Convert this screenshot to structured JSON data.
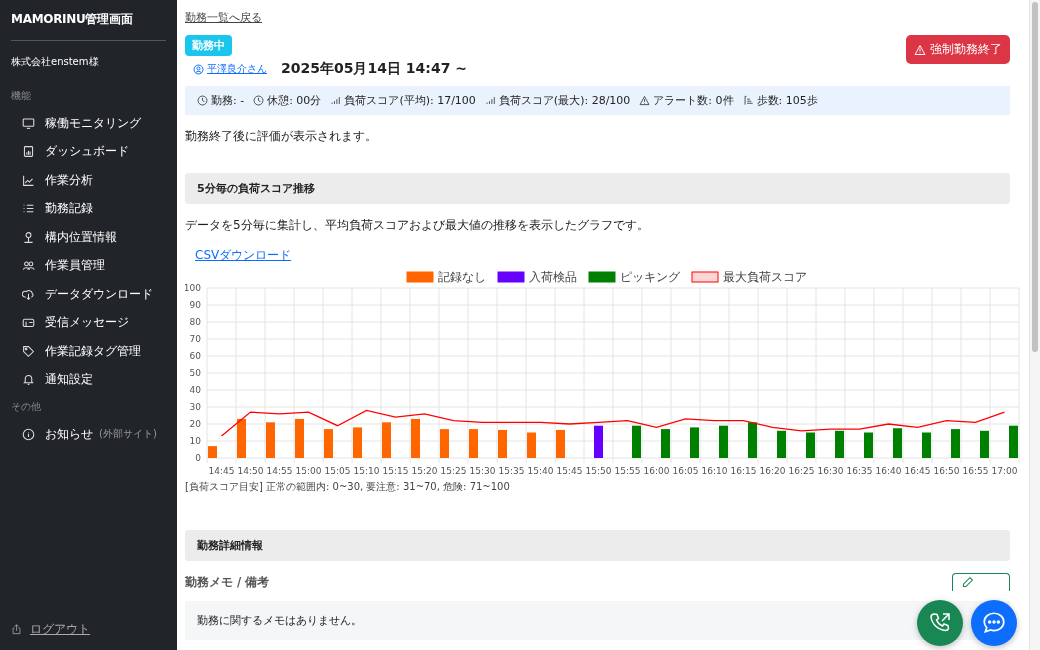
{
  "sidebar": {
    "title": "MAMORINU管理画面",
    "company": "株式会社enstem様",
    "sections": [
      {
        "heading": "機能",
        "items": [
          {
            "label": "稼働モニタリング"
          },
          {
            "label": "ダッシュボード"
          },
          {
            "label": "作業分析"
          },
          {
            "label": "勤務記録"
          },
          {
            "label": "構内位置情報"
          },
          {
            "label": "作業員管理"
          },
          {
            "label": "データダウンロード"
          },
          {
            "label": "受信メッセージ"
          },
          {
            "label": "作業記録タグ管理"
          },
          {
            "label": "通知設定"
          }
        ]
      },
      {
        "heading": "その他",
        "items": [
          {
            "label": "お知らせ",
            "note": "(外部サイト)"
          }
        ]
      }
    ],
    "logout": "ログアウト"
  },
  "back_link": "勤務一覧へ戻る",
  "status_badge": "勤務中",
  "force_end_button": "強制勤務終了",
  "worker_link": "平澤良介さん",
  "shift_title": "2025年05月14日 14:47 ~",
  "stats": [
    "勤務: -",
    "休憩: 00分",
    "負荷スコア(平均): 17/100",
    "負荷スコア(最大): 28/100",
    "アラート数: 0件",
    "歩数: 105歩"
  ],
  "evaluation_note": "勤務終了後に評価が表示されます。",
  "score_section": {
    "heading": "5分毎の負荷スコア推移",
    "description": "データを5分毎に集計し、平均負荷スコアおよび最大値の推移を表示したグラフです。",
    "csv_link": "CSVダウンロード",
    "chart_data": {
      "type": "bar",
      "categories": [
        "14:45",
        "14:50",
        "14:55",
        "15:00",
        "15:05",
        "15:10",
        "15:15",
        "15:20",
        "15:25",
        "15:30",
        "15:35",
        "15:40",
        "15:45",
        "15:50",
        "15:55",
        "16:00",
        "16:05",
        "16:10",
        "16:15",
        "16:20",
        "16:25",
        "16:30",
        "16:35",
        "16:40",
        "16:45",
        "16:50",
        "16:55",
        "17:00"
      ],
      "series": [
        {
          "name": "記録なし",
          "color": "#ff6600",
          "type": "bar",
          "values": [
            7,
            23,
            21,
            23,
            17,
            18,
            21,
            23,
            17,
            17,
            16.5,
            15,
            16.5,
            null,
            null,
            null,
            null,
            null,
            null,
            null,
            null,
            null,
            null,
            null,
            null,
            null,
            null,
            null
          ]
        },
        {
          "name": "入荷検品",
          "color": "#6600ff",
          "type": "bar",
          "values": [
            null,
            null,
            null,
            null,
            null,
            null,
            null,
            null,
            null,
            null,
            null,
            null,
            null,
            19,
            null,
            null,
            null,
            null,
            null,
            null,
            null,
            null,
            null,
            null,
            null,
            null,
            null,
            null
          ]
        },
        {
          "name": "ピッキング",
          "color": "#008000",
          "type": "bar",
          "values": [
            null,
            null,
            null,
            null,
            null,
            null,
            null,
            null,
            null,
            null,
            null,
            null,
            null,
            null,
            19,
            17,
            18,
            19,
            21,
            16,
            15,
            16,
            15,
            17.5,
            15,
            17,
            16,
            19
          ]
        },
        {
          "name": "最大負荷スコア",
          "color": "#ff0000",
          "type": "line",
          "values": [
            13,
            27,
            26,
            27,
            19,
            28,
            24,
            26,
            22,
            21,
            21,
            21,
            20,
            21,
            22,
            18,
            23,
            22,
            22,
            18,
            16,
            17,
            17,
            20,
            18,
            22,
            21,
            27
          ]
        }
      ],
      "ylim": [
        0,
        100
      ],
      "grid": true,
      "legend": true,
      "yticks": [
        0,
        10,
        20,
        30,
        40,
        50,
        60,
        70,
        80,
        90,
        100
      ]
    },
    "guide": "[負荷スコア目安] 正常の範囲内: 0~30, 要注意: 31~70, 危険: 71~100"
  },
  "detail_section": {
    "heading": "勤務詳細情報",
    "memo_label": "勤務メモ / 備考",
    "memo_text": "勤務に関するメモはありません。"
  }
}
